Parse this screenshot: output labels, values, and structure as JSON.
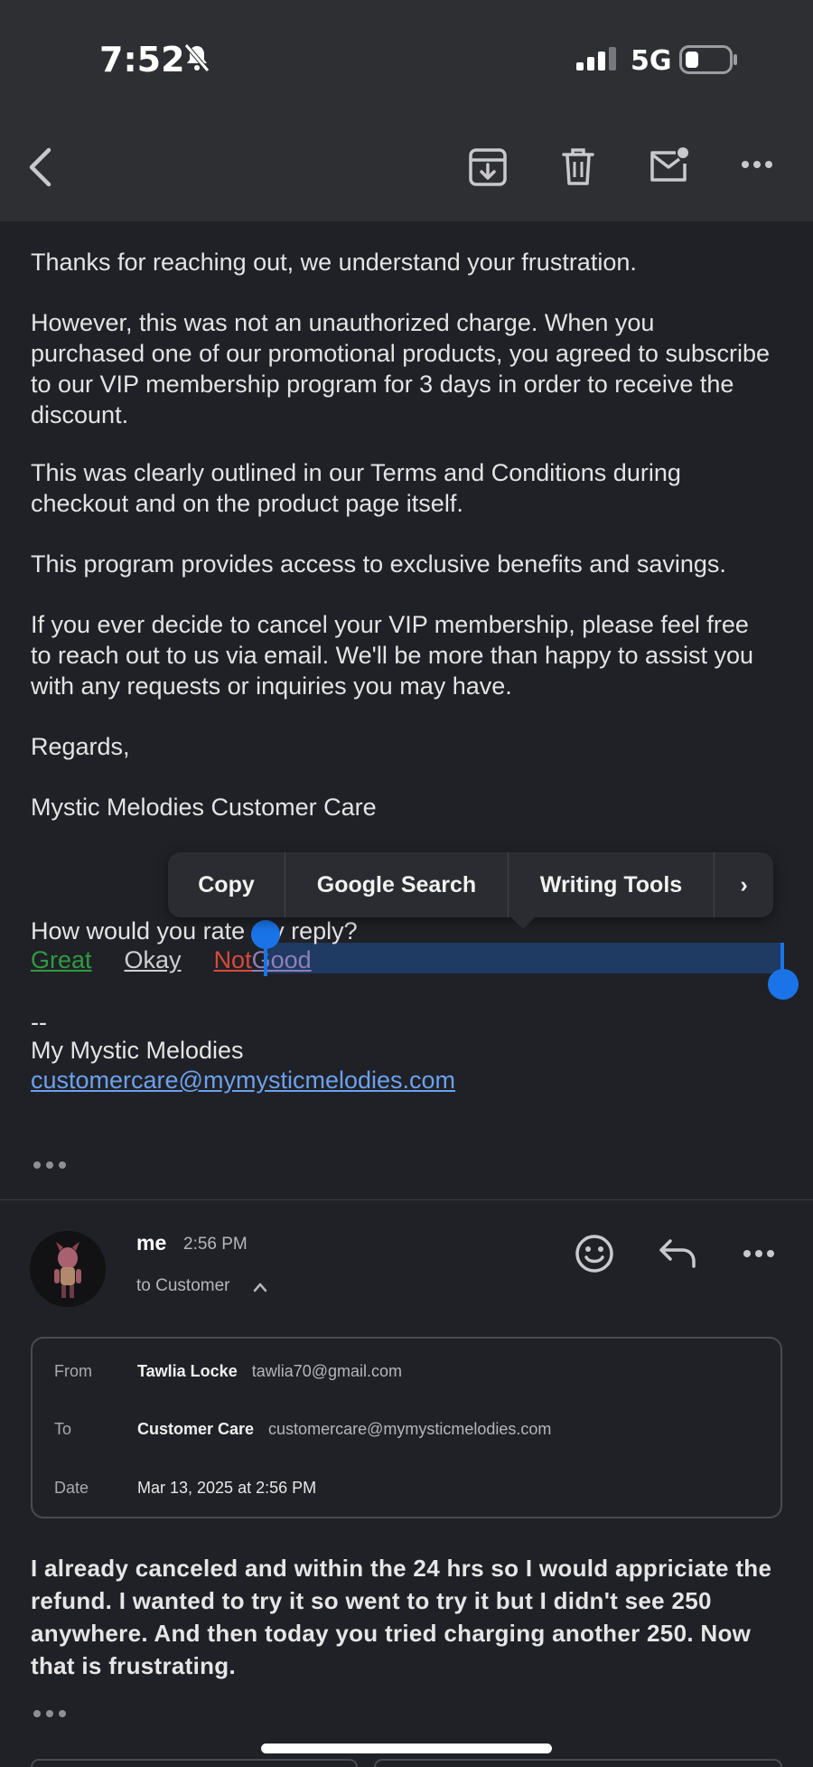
{
  "status_bar": {
    "time": "7:52",
    "network": "5G"
  },
  "toolbar": {
    "back_label": "back",
    "archive_label": "archive",
    "trash_label": "trash",
    "mark_label": "mark unread",
    "more_label": "more"
  },
  "email": {
    "paragraphs": [
      "Thanks for reaching out, we understand your frustration.",
      "However, this was not an unauthorized charge. When you purchased one of our promotional products, you agreed to subscribe to our VIP membership program for 3 days in order to receive the discount.",
      "This was clearly outlined in our Terms and Conditions during checkout and on the product page itself.",
      "This program provides access to exclusive benefits and savings.",
      "If you ever decide to cancel your VIP membership, please feel free to reach out to us via email. We'll be more than happy to assist you with any requests or inquiries you may have.",
      "Regards,",
      "Mystic Melodies Customer Care"
    ],
    "rating_question": "How would you rate my reply?",
    "rating_options": {
      "great": "Great",
      "okay": "Okay",
      "not": "Not",
      "good": "Good"
    },
    "signature_dash": "--",
    "signature_name": "My Mystic Melodies",
    "signature_email": "customercare@mymysticmelodies.com"
  },
  "context_menu": {
    "copy": "Copy",
    "google_search": "Google Search",
    "writing_tools": "Writing Tools",
    "more": "›"
  },
  "reply_message": {
    "sender": "me",
    "time": "2:56 PM",
    "to_line": "to Customer",
    "details": {
      "from_label": "From",
      "from_name": "Tawlia Locke",
      "from_email": "tawlia70@gmail.com",
      "to_label": "To",
      "to_name": "Customer Care",
      "to_email": "customercare@mymysticmelodies.com",
      "date_label": "Date",
      "date_value": "Mar 13, 2025 at 2:56 PM"
    },
    "body": "I already canceled and within the 24 hrs so I would appriciate the refund. I wanted to try it so went to try it but I didn't see 250 anywhere. And then today you tried charging another 250. Now that is frustrating."
  },
  "colors": {
    "accent": "#1a74e8",
    "link": "#6ba1ee",
    "great": "#2f9a43",
    "not": "#d64a3c",
    "good": "#8f7fb8"
  }
}
